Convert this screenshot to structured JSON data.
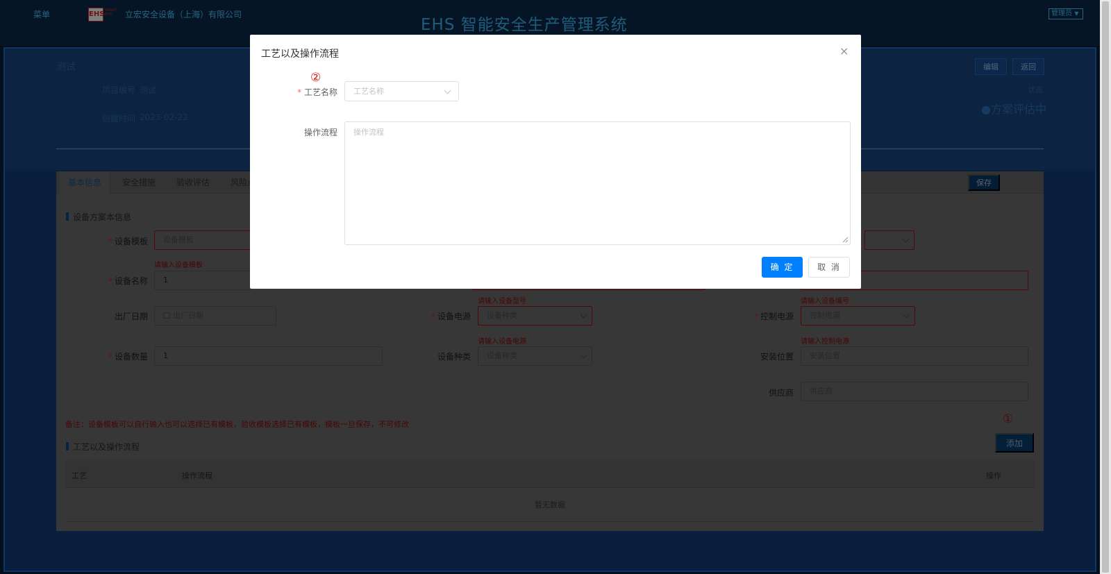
{
  "topbar": {
    "menu_label": "菜单",
    "logo_text": "EHS",
    "logo_subtext": "SMART EHS",
    "company_name": "立宏安全设备（上海）有限公司",
    "system_title": "EHS 智能安全生产管理系统",
    "user_menu": "管理员"
  },
  "project": {
    "title": "测试",
    "number_label": "项目编号",
    "number_value": "测试",
    "created_label": "创建时间",
    "created_value": "2023-02-22",
    "edit_label": "编辑",
    "back_label": "返回",
    "status_label": "状态",
    "status_value": "●方案评估中"
  },
  "tabs": [
    "基本信息",
    "安全措施",
    "验收评估",
    "风险点"
  ],
  "save_label": "保存",
  "form": {
    "section_title": "设备方案本信息",
    "fields": {
      "template_label": "设备模板",
      "template_placeholder": "设备模板",
      "template_error": "请输入设备模板",
      "name_label": "设备名称",
      "name_value": "1",
      "model_error": "请输入设备型号",
      "number_error": "请输入设备编号",
      "factory_date_label": "出厂日期",
      "factory_date_placeholder": "出厂日期",
      "power_label": "设备电源",
      "power_placeholder": "设备种类",
      "power_error": "请输入设备电源",
      "control_label": "控制电源",
      "control_placeholder": "控制电源",
      "control_error": "请输入控制电源",
      "qty_label": "设备数量",
      "qty_value": "1",
      "type_label": "设备种类",
      "type_placeholder": "设备种类",
      "location_label": "安装位置",
      "location_placeholder": "安装位置",
      "supplier_label": "供应商",
      "supplier_placeholder": "供应商"
    },
    "note": "备注：设备模板可以自行输入也可以选择已有模板，验收模板选择已有模板，模板一旦保存，不可修改",
    "process_section_title": "工艺以及操作流程",
    "add_label": "添加",
    "marker_1": "①",
    "table": {
      "columns": [
        "工艺",
        "操作流程",
        "操作"
      ],
      "empty_text": "暂无数据"
    }
  },
  "modal": {
    "title": "工艺以及操作流程",
    "close_icon": "×",
    "marker_2": "②",
    "process_label": "工艺名称",
    "process_placeholder": "工艺名称",
    "flow_label": "操作流程",
    "flow_placeholder": "操作流程",
    "confirm_label": "确 定",
    "cancel_label": "取 消"
  },
  "colors": {
    "accent": "#0080ff",
    "title_blue": "#3fb7f5",
    "error_red": "#f56c6c"
  }
}
